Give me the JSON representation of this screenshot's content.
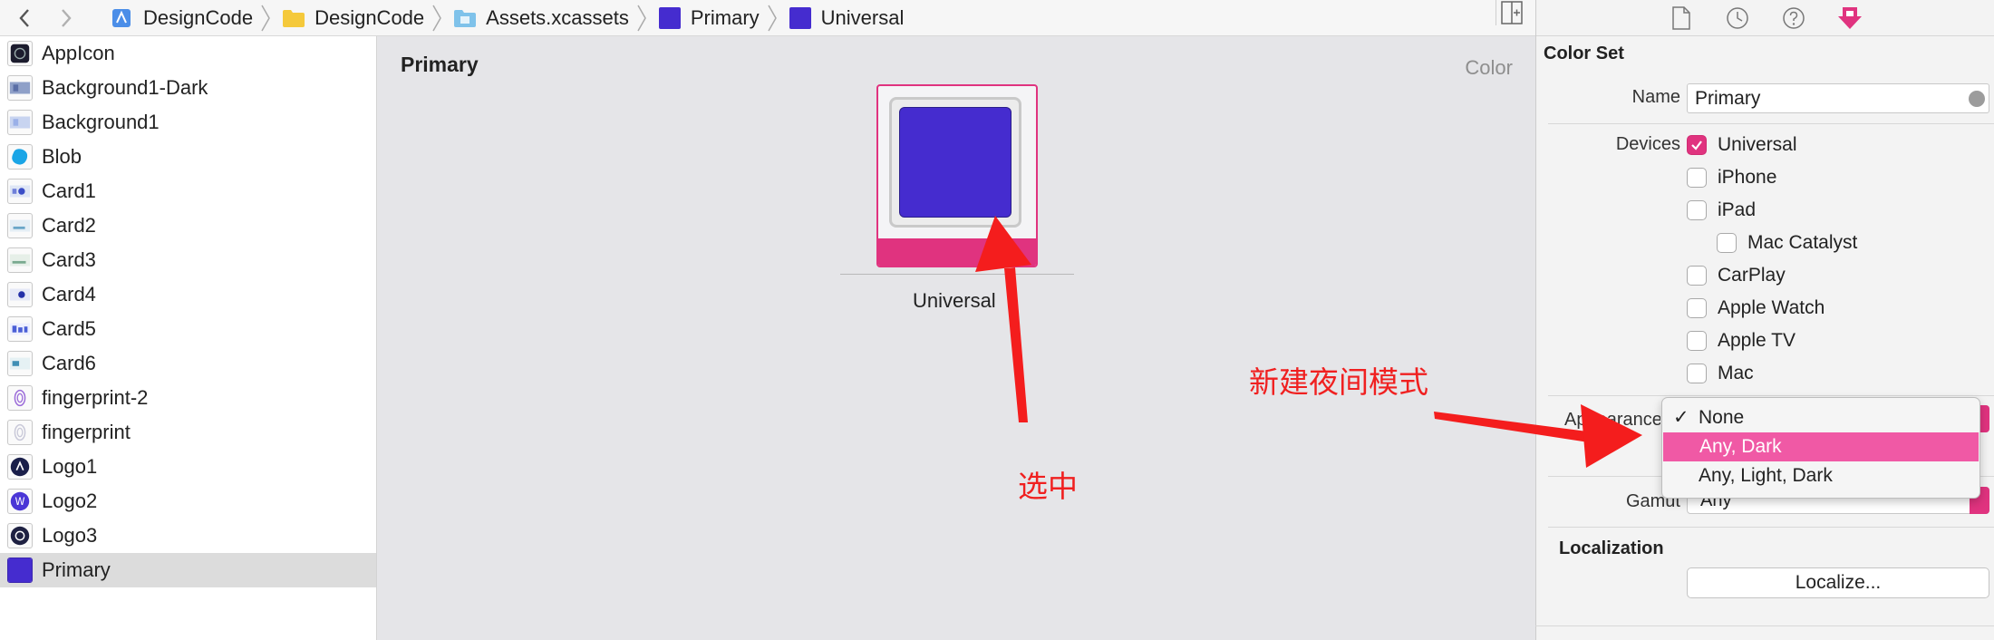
{
  "breadcrumb": {
    "items": [
      {
        "label": "DesignCode",
        "icon": "xcode-project-icon"
      },
      {
        "label": "DesignCode",
        "icon": "folder-icon"
      },
      {
        "label": "Assets.xcassets",
        "icon": "asset-catalog-icon"
      },
      {
        "label": "Primary",
        "icon": "color-set-icon"
      },
      {
        "label": "Universal",
        "icon": "color-swatch-icon"
      }
    ]
  },
  "assets": [
    {
      "label": "AppIcon"
    },
    {
      "label": "Background1-Dark"
    },
    {
      "label": "Background1"
    },
    {
      "label": "Blob"
    },
    {
      "label": "Card1"
    },
    {
      "label": "Card2"
    },
    {
      "label": "Card3"
    },
    {
      "label": "Card4"
    },
    {
      "label": "Card5"
    },
    {
      "label": "Card6"
    },
    {
      "label": "fingerprint-2"
    },
    {
      "label": "fingerprint"
    },
    {
      "label": "Logo1"
    },
    {
      "label": "Logo2"
    },
    {
      "label": "Logo3"
    },
    {
      "label": "Primary",
      "selected": true
    }
  ],
  "editor": {
    "title": "Primary",
    "kind": "Color",
    "swatch_label": "Universal",
    "swatch_color": "#452ccf"
  },
  "annotations": {
    "select_note": "选中",
    "dark_mode_note": "新建夜间模式",
    "arrow_color": "#f41d1d"
  },
  "inspector": {
    "section_title": "Color Set",
    "name_label": "Name",
    "name_value": "Primary",
    "devices_label": "Devices",
    "devices": [
      {
        "label": "Universal",
        "checked": true
      },
      {
        "label": "iPhone",
        "checked": false
      },
      {
        "label": "iPad",
        "checked": false
      },
      {
        "label": "Mac Catalyst",
        "checked": false
      },
      {
        "label": "CarPlay",
        "checked": false
      },
      {
        "label": "Apple Watch",
        "checked": false
      },
      {
        "label": "Apple TV",
        "checked": false
      },
      {
        "label": "Mac",
        "checked": false
      }
    ],
    "appearance_label": "Appearances",
    "gamut_label": "Gamut",
    "gamut_value": "Any",
    "localization_title": "Localization",
    "localize_button": "Localize..."
  },
  "appearance_menu": {
    "options": [
      {
        "label": "None",
        "checked": true
      },
      {
        "label": "Any, Dark",
        "highlighted": true
      },
      {
        "label": "Any, Light, Dark"
      }
    ]
  },
  "colors": {
    "accent": "#e0337f",
    "menu_highlight": "#f059a5",
    "selection": "#dcdcdc"
  }
}
